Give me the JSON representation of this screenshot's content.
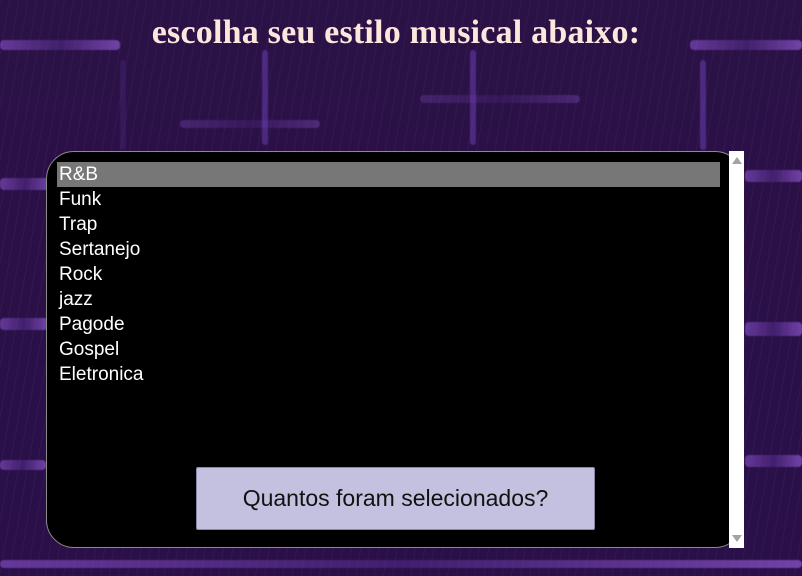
{
  "page": {
    "title": "escolha seu estilo musical abaixo:"
  },
  "genre_list": {
    "options": [
      "R&B",
      "Funk",
      "Trap",
      "Sertanejo",
      "Rock",
      "jazz",
      "Pagode",
      "Gospel",
      "Eletronica"
    ],
    "selected": "R&B"
  },
  "count_button": {
    "label": "Quantos foram selecionados?"
  },
  "colors": {
    "title_text": "#fde7dc",
    "list_background": "#000000",
    "selected_highlight": "#777777",
    "button_background": "#c3c1df",
    "page_background": "#2a1146"
  },
  "icons": {
    "scroll_up": "triangle-up-icon",
    "scroll_down": "triangle-down-icon"
  }
}
